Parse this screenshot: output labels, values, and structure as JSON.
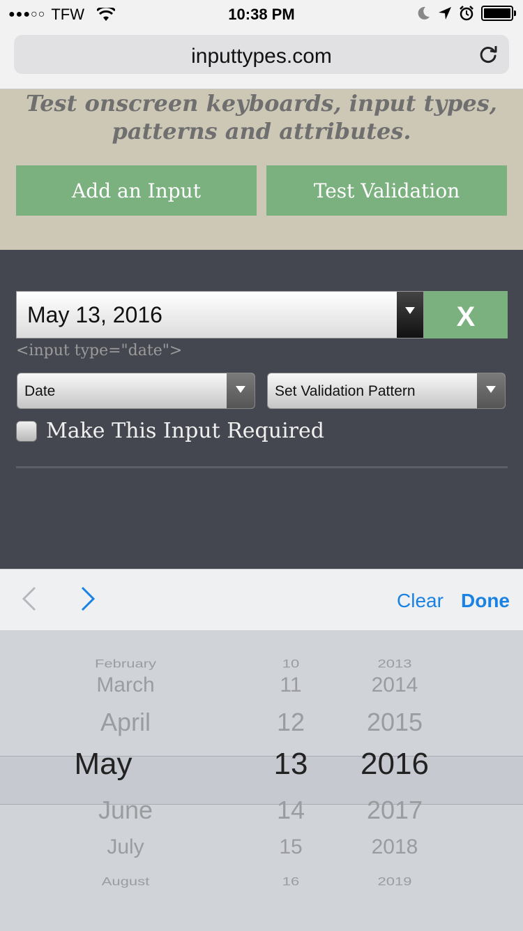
{
  "status_bar": {
    "signal": "●●●○○",
    "carrier": "TFW",
    "time": "10:38 PM"
  },
  "browser": {
    "url": "inputtypes.com"
  },
  "header": {
    "tagline_line1": "Test onscreen keyboards, input types,",
    "tagline_line2": "patterns and attributes.",
    "add_input_label": "Add an Input",
    "test_validation_label": "Test Validation"
  },
  "form": {
    "date_value": "May 13, 2016",
    "remove_label": "X",
    "input_caption": "<input type=\"date\">",
    "type_select_value": "Date",
    "pattern_select_value": "Set Validation Pattern",
    "required_label": "Make This Input Required",
    "required_checked": false
  },
  "accessory": {
    "clear_label": "Clear",
    "done_label": "Done"
  },
  "picker": {
    "months": [
      "February",
      "March",
      "April",
      "May",
      "June",
      "July",
      "August"
    ],
    "days": [
      "10",
      "11",
      "12",
      "13",
      "14",
      "15",
      "16"
    ],
    "years": [
      "2013",
      "2014",
      "2015",
      "2016",
      "2017",
      "2018",
      "2019"
    ],
    "selected": {
      "month": "May",
      "day": "13",
      "year": "2016"
    }
  }
}
